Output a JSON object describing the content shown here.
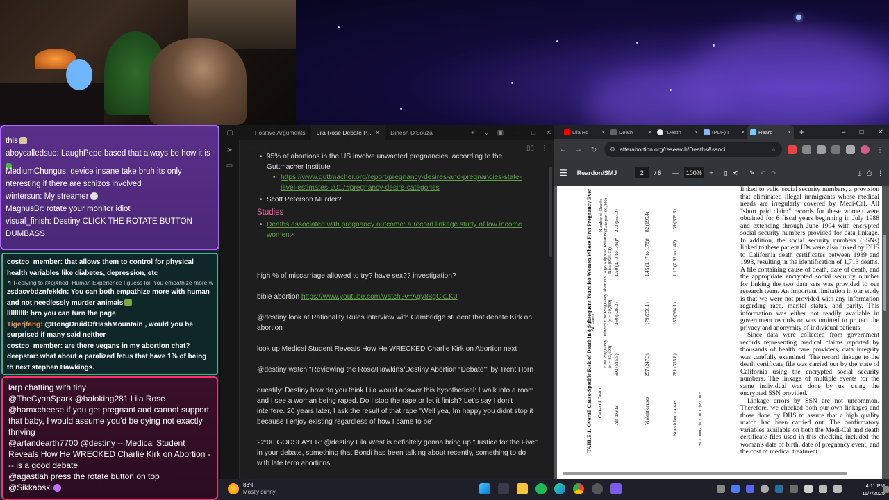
{
  "chat_top": {
    "messages": [
      {
        "text": "this"
      },
      {
        "user": "aboycalledsue:",
        "text": "LaughPepe based that always be how it is"
      },
      {
        "user": "MediumChungus:",
        "text": "device insane take bruh its only"
      },
      {
        "text": "nteresting if there are schizos involved"
      },
      {
        "user": "wintersun:",
        "text": "My streamer"
      },
      {
        "user": "MagnusBr:",
        "text": "rotate your monitor idiot"
      },
      {
        "user": "visual_finish:",
        "text": "Destiny CLICK THE ROTATE BUTTON"
      },
      {
        "text": "DUMBASS"
      }
    ]
  },
  "chat_mid": {
    "messages": [
      {
        "user": "costco_member:",
        "text": "that allows them to control for physical health variables like diabetes, depression, etc",
        "color": "white"
      },
      {
        "reply": "↰ Replying to @pj4hed: Human Experience I guess lol. You empathize more wi..."
      },
      {
        "user": "zsdacvbdznfekldn:",
        "text": "You can both empathize more with human and not needlessly murder animals",
        "color": "white"
      },
      {
        "user": "llllllllll:",
        "text": "bro you can turn the page",
        "color": "white"
      },
      {
        "user": "Tigerjfang:",
        "text": "@BongDruidOfHashMountain , would you be surprised if many said neither",
        "color": "orange"
      },
      {
        "user": "costco_member:",
        "text": "are there vegans in my abortion chat?",
        "color": "white"
      },
      {
        "user": "deepstar:",
        "text": "what about a paralized fetus that have 1% of being th next stephen Hawkings.",
        "color": "white"
      }
    ]
  },
  "chat_bottom": {
    "messages": [
      {
        "text": "larp chatting with tiny"
      },
      {
        "user": "@TheCyanSpark",
        "text": "@haloking281 Lila Rose"
      },
      {
        "user": "@hamxcheese",
        "text": "if you get pregnant and cannot support that baby, I would assume you'd be dying not exactly thriving"
      },
      {
        "user": "@artandearth7700",
        "text": "@destiny -- Medical Student Reveals How He WRECKED Charlie Kirk on Abortion - -- is a good debate"
      },
      {
        "user": "@agastiah",
        "text": "press the rotate button on top"
      },
      {
        "user": "@Sikkabski",
        "text": ""
      }
    ]
  },
  "obsidian": {
    "tabs": [
      {
        "label": "Positive Arguments",
        "active": false
      },
      {
        "label": "Lila Rose Debate P...",
        "active": true,
        "close": "×"
      },
      {
        "label": "Dinesh D'Souza",
        "active": false
      }
    ],
    "content": {
      "bullet1": "95% of abortions in the US involve unwanted pregnancies, according to the Guttmacher Institute",
      "bullet1_link": "https://www.guttmacher.org/report/pregnancy-desires-and-pregnancies-state-level-estimates-2017#pregnancy-desire-categories",
      "bullet2": "Scott Peterson Murder?",
      "heading": "Studies",
      "study_link": "Deaths associated with pregnancy outcome: a record linkage study of low income women",
      "p1": "high % of miscarriage allowed to try? have sex?? investigation?",
      "p2_text": "bible abortion",
      "p2_link": "https://www.youtube.com/watch?v=Agy88gCk1K0",
      "p3": "@destiny look at Rationality Rules interview with Cambridge student that debate Kirk on abortion",
      "p4": "look up Medical Student Reveals How He WRECKED Charlie Kirk on Abortion next",
      "p5": "@destiny watch \"Reviewing the Rose/Hawkins/Destiny Abortion “Debate”\" by Trent Horn",
      "p6": "questily: Destiny how do you think Lila would answer this hypothetical: I walk into a room and I see a woman being raped. Do I stop the rape or let it finish? Let's say I don't interfere. 20 years later, I ask the result of that rape \"Well yea, Im happy you didnt stop it because I enjoy existing regardless of how I came to be\"",
      "p7": "22:00 GODSLAYER: @destiny Lila West is definitely gonna bring up ''Justice for the Five'' in your debate, something that Bondi has been talking about recently, something to do with late term abortions"
    }
  },
  "chrome": {
    "tabs": [
      {
        "label": "Lila Ro",
        "color": "#ff0000"
      },
      {
        "label": "Death",
        "color": "#5f6368"
      },
      {
        "label": "\"Death",
        "color": "#e8eaed"
      },
      {
        "label": "(PDF) I",
        "color": "#8ab4f8"
      },
      {
        "label": "Reard",
        "color": "#7cc8ff",
        "active": true
      }
    ],
    "url": "afterabortion.org/research/DeathsAssoci...",
    "pdf": {
      "title": "Reardon/SMJ",
      "page": "2",
      "page_total": "/ 8",
      "zoom": "100%",
      "body_paragraphs": [
        "linked to valid social security numbers, a provision that eliminated illegal immigrants whose medical needs are irregularly covered by Medi-Cal. All \"short paid claim\" records for these women were obtained for 6 fiscal years beginning in July 1988 and extending through June 1994 with encrypted social security numbers provided for data linkage. In addition, the social security numbers (SSNs) linked to these patient IDs were also linked by DHS to California death certificates between 1989 and 1998, resulting in the identification of 1,713 deaths. A file containing cause of death, date of death, and the appropriate encrypted social security number for linking the two data sets was provided to our research team. An important limitation in our study is that we were not provided with any information regarding race, marital status, and parity. This information was either not readily available in government records or was omitted to protect the privacy and anonymity of individual patients.",
        "Since data were collected from government records representing medical claims reported by thousands of health care providers, data integrity was carefully examined. The record linkage to the death certificate file was carried out by the state of California using the encrypted social security numbers. The linkage of multiple events for the same individual was done by us, using the encrypted SSN provided.",
        "Linkage errors by SSN are not uncommon. Therefore, we checked both our own linkages and those done by DHS to assure that a high quality match had been carried out. The confirmatory variables available on both the Medi-Cal and death certificate files used in this checking included the woman's date of birth, date of pregnancy event, and the cost of medical treatment."
      ],
      "table": {
        "caption": "TABLE 1. Overall Cause-Specific Risk of Death in 8 Subsequent Years for Women Whose First Pregnancy Event Was an Abort",
        "col_cause": "Cause of Death",
        "col_group": "All Cases",
        "col_first": "First Pregnancy Abortion (n = 50,780)",
        "col_delivery": "First Pregnancy Delivery (n = 83,690)",
        "col_adjusted": "Age-Adjusted Relative Risk (95% CI)",
        "col_deaths": "Number of Deaths (Rate per 100,000)",
        "rows": [
          {
            "cause": "All deaths",
            "delivery": "690 (585.5)",
            "abortion": "360 (728.2)",
            "rr": "1.50 (1.13 to 1.49)*",
            "n": "273 (557.0)"
          },
          {
            "cause": "Violent causes",
            "delivery": "257 (247.3)",
            "abortion": "179 (356.1)",
            "rr": "1.45 (1.17 to 1.78)†",
            "n": "82 (195.4)"
          },
          {
            "cause": "Nonviolent causes",
            "delivery": "281 (335.8)",
            "abortion": "183 (364.1)",
            "rr": "1.17 (0.92 to 1.42)",
            "n": "139 (309.8)"
          }
        ],
        "footnotes": "*P < .0002. †P < .001. ‡P < .005."
      }
    }
  },
  "taskbar": {
    "temp": "83°F",
    "weather": "Mostly sunny",
    "time": "4:11 PM",
    "date": "11/7/2025"
  }
}
